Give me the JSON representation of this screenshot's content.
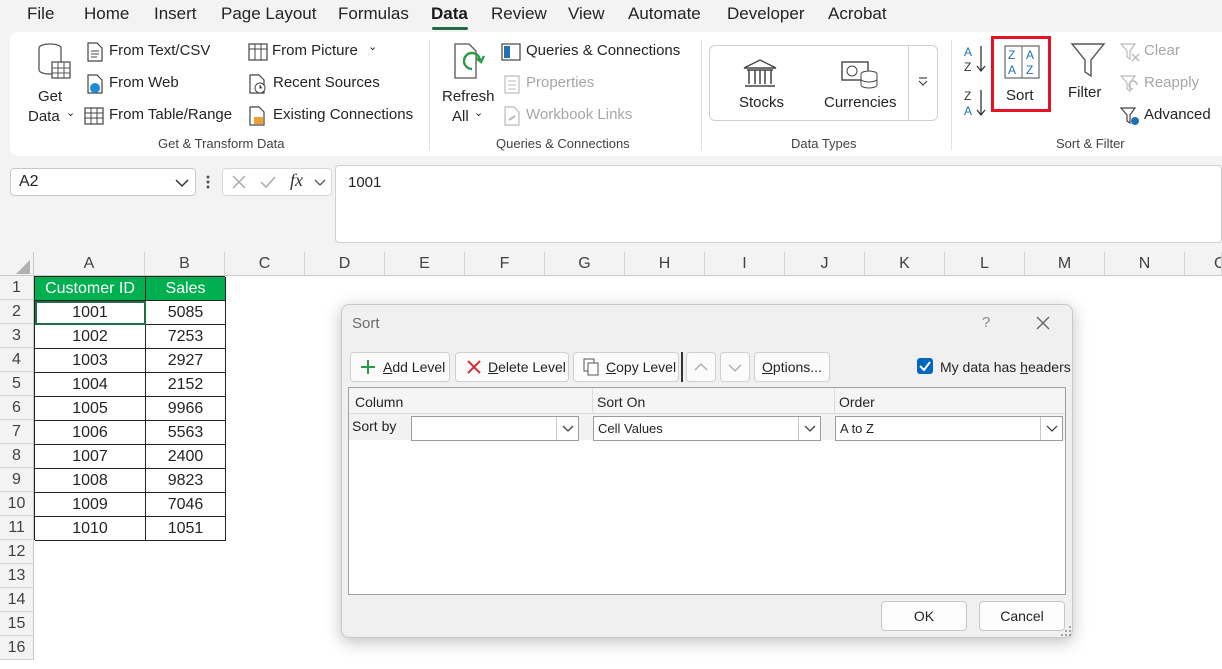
{
  "menu": {
    "tabs": [
      "File",
      "Home",
      "Insert",
      "Page Layout",
      "Formulas",
      "Data",
      "Review",
      "View",
      "Automate",
      "Developer",
      "Acrobat"
    ],
    "active": "Data"
  },
  "ribbon": {
    "get_data_line1": "Get",
    "get_data_line2": "Data",
    "from_text_csv": "From Text/CSV",
    "from_web": "From Web",
    "from_table_range": "From Table/Range",
    "from_picture": "From Picture",
    "recent_sources": "Recent Sources",
    "existing_connections": "Existing Connections",
    "group_get_transform": "Get & Transform Data",
    "refresh_line1": "Refresh",
    "refresh_line2": "All",
    "queries_connections": "Queries & Connections",
    "properties": "Properties",
    "workbook_links": "Workbook Links",
    "group_queries": "Queries & Connections",
    "stocks": "Stocks",
    "currencies": "Currencies",
    "group_data_types": "Data Types",
    "sort": "Sort",
    "filter": "Filter",
    "clear": "Clear",
    "reapply": "Reapply",
    "advanced": "Advanced",
    "group_sort_filter": "Sort & Filter",
    "highlight_color": "#e81123"
  },
  "formula_bar": {
    "name_box": "A2",
    "formula": "1001"
  },
  "sheet": {
    "columns": [
      "A",
      "B",
      "C",
      "D",
      "E",
      "F",
      "G",
      "H",
      "I",
      "J",
      "K",
      "L",
      "M",
      "N",
      "O"
    ],
    "rows": [
      "1",
      "2",
      "3",
      "4",
      "5",
      "6",
      "7",
      "8",
      "9",
      "10",
      "11",
      "12",
      "13",
      "14",
      "15",
      "16"
    ],
    "header": [
      "Customer ID",
      "Sales"
    ],
    "data": [
      [
        "1001",
        "5085"
      ],
      [
        "1002",
        "7253"
      ],
      [
        "1003",
        "2927"
      ],
      [
        "1004",
        "2152"
      ],
      [
        "1005",
        "9966"
      ],
      [
        "1006",
        "5563"
      ],
      [
        "1007",
        "2400"
      ],
      [
        "1008",
        "9823"
      ],
      [
        "1009",
        "7046"
      ],
      [
        "1010",
        "1051"
      ]
    ],
    "header_color": "#00b050"
  },
  "dialog": {
    "title": "Sort",
    "help": "?",
    "add_level_u": "A",
    "add_level_rest": "dd Level",
    "delete_level_u": "D",
    "delete_level_rest": "elete Level",
    "copy_level_u": "C",
    "copy_level_rest": "opy Level",
    "options_u": "O",
    "options_rest": "ptions...",
    "headers_pre": "My data has ",
    "headers_u": "h",
    "headers_rest": "eaders",
    "headers_checked": true,
    "col_column": "Column",
    "col_sort_on": "Sort On",
    "col_order": "Order",
    "sort_by": "Sort by",
    "sort_by_value": "",
    "sort_on_value": "Cell Values",
    "order_value": "A to Z",
    "ok": "OK",
    "cancel": "Cancel"
  }
}
